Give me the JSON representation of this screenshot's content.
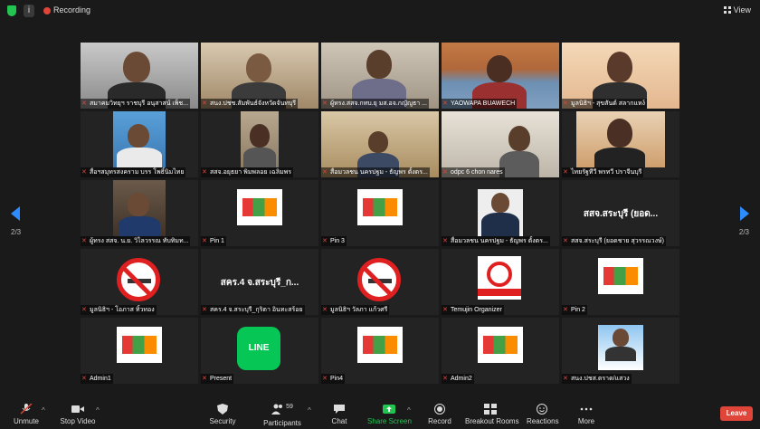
{
  "topbar": {
    "recording_label": "Recording",
    "view_label": "View"
  },
  "pager": {
    "left_indicator": "2/3",
    "right_indicator": "2/3"
  },
  "tiles": [
    {
      "name": "สมาคมวิทยุฯ ราชบุรี อนุสาสน์ เพ็ช..."
    },
    {
      "name": "สนง.ปชช.สัมพันธ์จังหวัดจันทบุรี"
    },
    {
      "name": "ผู้ทรง.สสจ.กทบ.ยุ มส.อจ.กญัญูธา ..."
    },
    {
      "name": "YAOWAPA BUAWECH"
    },
    {
      "name": "มูลนิธิฯ - สุขสันต์ สลากแหง์"
    },
    {
      "name": "สื่อฯสมุทรสงคราม บรร โพธิ์นิมไทย"
    },
    {
      "name": "สสจ.อยุธยา พิมพลอย เฉลิมพร"
    },
    {
      "name": "สื่อมวลชน นครปฐม - ธัญพร ตั้งตร..."
    },
    {
      "name": "odpc 6 chon nares"
    },
    {
      "name": "ไทยรัฐทีวี พรทวี ปราจีนบุรี"
    },
    {
      "name": "ผู้ทรง สสจ. น.ย. วิไลวรรณ ทับทิมท..."
    },
    {
      "name": "Pin 1"
    },
    {
      "name": "Pin 3"
    },
    {
      "name": "สื่อมวลชน นครปฐม - ธัญพร ตั้งตร..."
    },
    {
      "name": "สสจ.สระบุรี (ยอดชาย สุวรรณวงษ์)",
      "big": "สสจ.สระบุรี (ยอด..."
    },
    {
      "name": "มูลนิธิฯ - โอภาส ทิ้วทอง"
    },
    {
      "name": "สคร.4 จ.สระบุรี_กุริตา อินทะสร้อย",
      "big": "สคร.4 จ.สระบุรี_ก..."
    },
    {
      "name": "มูลนิธิฯ วัลภา แก้วศรี"
    },
    {
      "name": "Temujin Organizer"
    },
    {
      "name": "Pin 2"
    },
    {
      "name": "Admin1"
    },
    {
      "name": "Present"
    },
    {
      "name": "Pin4"
    },
    {
      "name": "Admin2"
    },
    {
      "name": "สนง.ปชส.ตราด/แสวง"
    }
  ],
  "logos": {
    "line_text": "LINE"
  },
  "toolbar": {
    "unmute": "Unmute",
    "stop_video": "Stop Video",
    "security": "Security",
    "participants": "Participants",
    "participants_count": "59",
    "chat": "Chat",
    "share_screen": "Share Screen",
    "record": "Record",
    "breakout": "Breakout Rooms",
    "reactions": "Reactions",
    "more": "More",
    "leave": "Leave"
  },
  "colors": {
    "accent": "#2d8cff",
    "leave": "#e0453a",
    "share": "#23c552",
    "background": "#1a1a1a"
  }
}
